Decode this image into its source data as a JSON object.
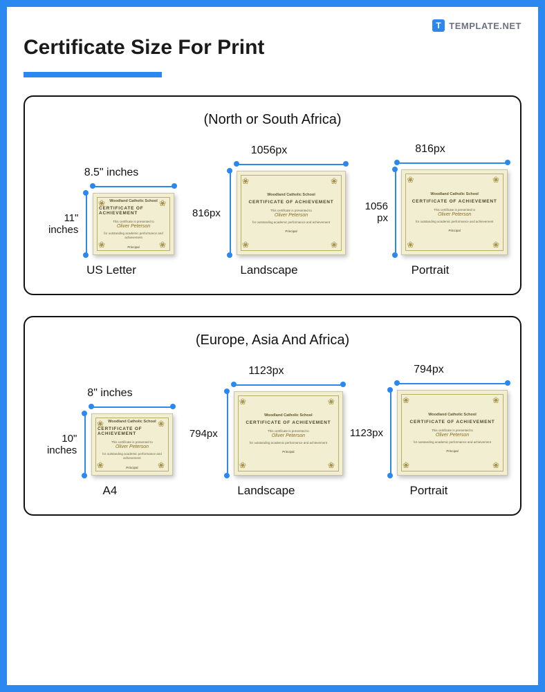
{
  "brand": {
    "name": "TEMPLATE.NET",
    "icon_letter": "T"
  },
  "title": "Certificate Size For Print",
  "cert_sample": {
    "school": "Woodland Catholic School",
    "heading": "CERTIFICATE OF ACHIEVEMENT",
    "presented": "This certificate is presented to",
    "name": "Oliver Peterson",
    "body": "for outstanding academic performance and achievement",
    "signer": "Principal"
  },
  "panels": [
    {
      "region": "(North or South Africa)",
      "items": [
        {
          "width_label": "8.5\" inches",
          "height_label": "11\"\ninches",
          "caption": "US Letter",
          "size_class": "sz-sm"
        },
        {
          "width_label": "1056px",
          "height_label": "816px",
          "caption": "Landscape",
          "size_class": "sz-md"
        },
        {
          "width_label": "816px",
          "height_label": "1056 px",
          "caption": "Portrait",
          "size_class": "sz-lg"
        }
      ]
    },
    {
      "region": "(Europe, Asia And Africa)",
      "items": [
        {
          "width_label": "8\" inches",
          "height_label": "10\"\ninches",
          "caption": "A4",
          "size_class": "sz-sm"
        },
        {
          "width_label": "1123px",
          "height_label": "794px",
          "caption": "Landscape",
          "size_class": "sz-md"
        },
        {
          "width_label": "794px",
          "height_label": "1123px",
          "caption": "Portrait",
          "size_class": "sz-lg"
        }
      ]
    }
  ]
}
